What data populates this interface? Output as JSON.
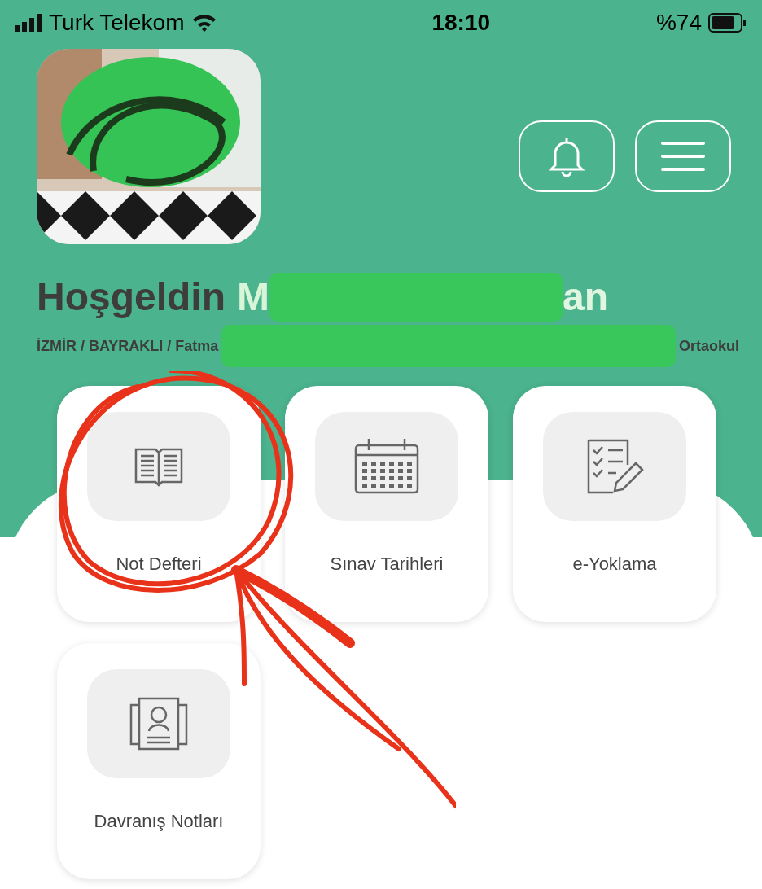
{
  "status_bar": {
    "carrier": "Turk Telekom",
    "time": "18:10",
    "battery": "%74"
  },
  "header": {
    "greeting": "Hoşgeldin",
    "name_start": "M",
    "name_end": "an",
    "location_start": "İZMİR / BAYRAKLI / Fatma",
    "location_end": "Ortaokul"
  },
  "menu_items": [
    {
      "label": "Not Defteri",
      "kind": "book"
    },
    {
      "label": "Sınav Tarihleri",
      "kind": "calendar"
    },
    {
      "label": "e-Yoklama",
      "kind": "checklist"
    },
    {
      "label": "Davranış Notları",
      "kind": "profile"
    }
  ]
}
